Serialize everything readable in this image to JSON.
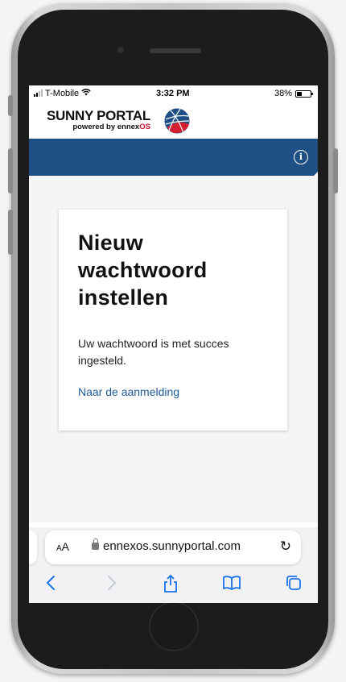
{
  "status_bar": {
    "carrier": "T-Mobile",
    "time": "3:32 PM",
    "battery": "38%",
    "battery_level": 0.38
  },
  "logo": {
    "title": "SUNNY PORTAL",
    "subtitle_prefix": "powered by ennex",
    "subtitle_suffix": "OS"
  },
  "navbar": {
    "info_icon": "info-icon",
    "info_glyph": "i"
  },
  "card": {
    "title": "Nieuw wachtwoord instellen",
    "message": "Uw wachtwoord is met succes ingesteld.",
    "link": "Naar de aanmelding"
  },
  "safari": {
    "text_size_label_small": "A",
    "text_size_label_large": "A",
    "url": "ennexos.sunnyportal.com",
    "icons": [
      "back-icon",
      "forward-icon",
      "share-icon",
      "bookmarks-icon",
      "tabs-icon"
    ]
  },
  "colors": {
    "navbar": "#1f5085",
    "link": "#1e5a94",
    "ios_blue": "#1a73e8",
    "brand_red": "#c8102e"
  }
}
